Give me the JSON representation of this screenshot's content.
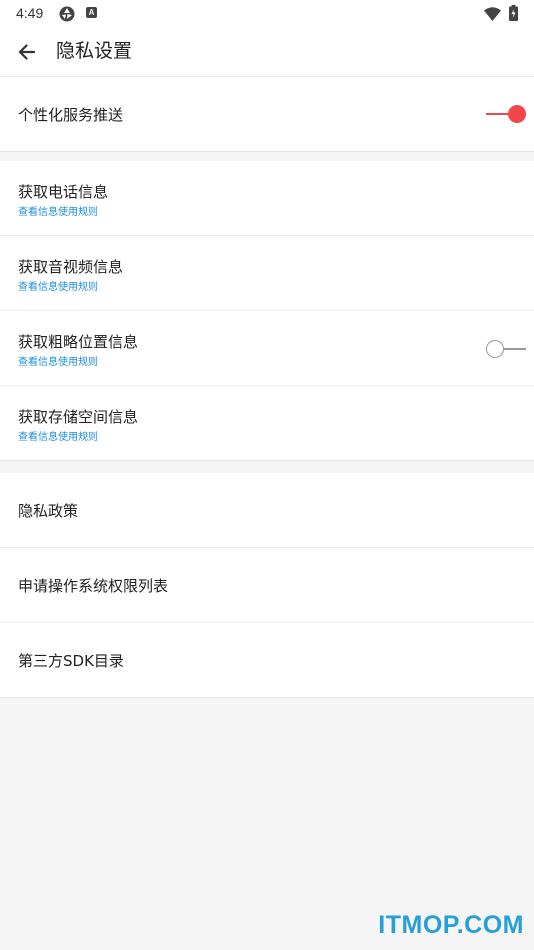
{
  "status_bar": {
    "time": "4:49",
    "badge_letter": "A"
  },
  "header": {
    "title": "隐私设置",
    "back_icon": "arrow-left-icon"
  },
  "groups": [
    {
      "rows": [
        {
          "title": "个性化服务推送",
          "toggle": "on"
        }
      ]
    },
    {
      "rows": [
        {
          "title": "获取电话信息",
          "link": "查看信息使用规则"
        },
        {
          "title": "获取音视频信息",
          "link": "查看信息使用规则"
        },
        {
          "title": "获取粗略位置信息",
          "link": "查看信息使用规则",
          "toggle": "off"
        },
        {
          "title": "获取存储空间信息",
          "link": "查看信息使用规则"
        }
      ]
    },
    {
      "rows": [
        {
          "title": "隐私政策"
        },
        {
          "title": "申请操作系统权限列表"
        },
        {
          "title": "第三方SDK目录"
        }
      ]
    }
  ],
  "watermark": "ITMOP.COM",
  "colors": {
    "accent": "#f0474b",
    "link": "#1e8fe1",
    "background": "#f5f5f5",
    "watermark": "#27a0d8"
  }
}
